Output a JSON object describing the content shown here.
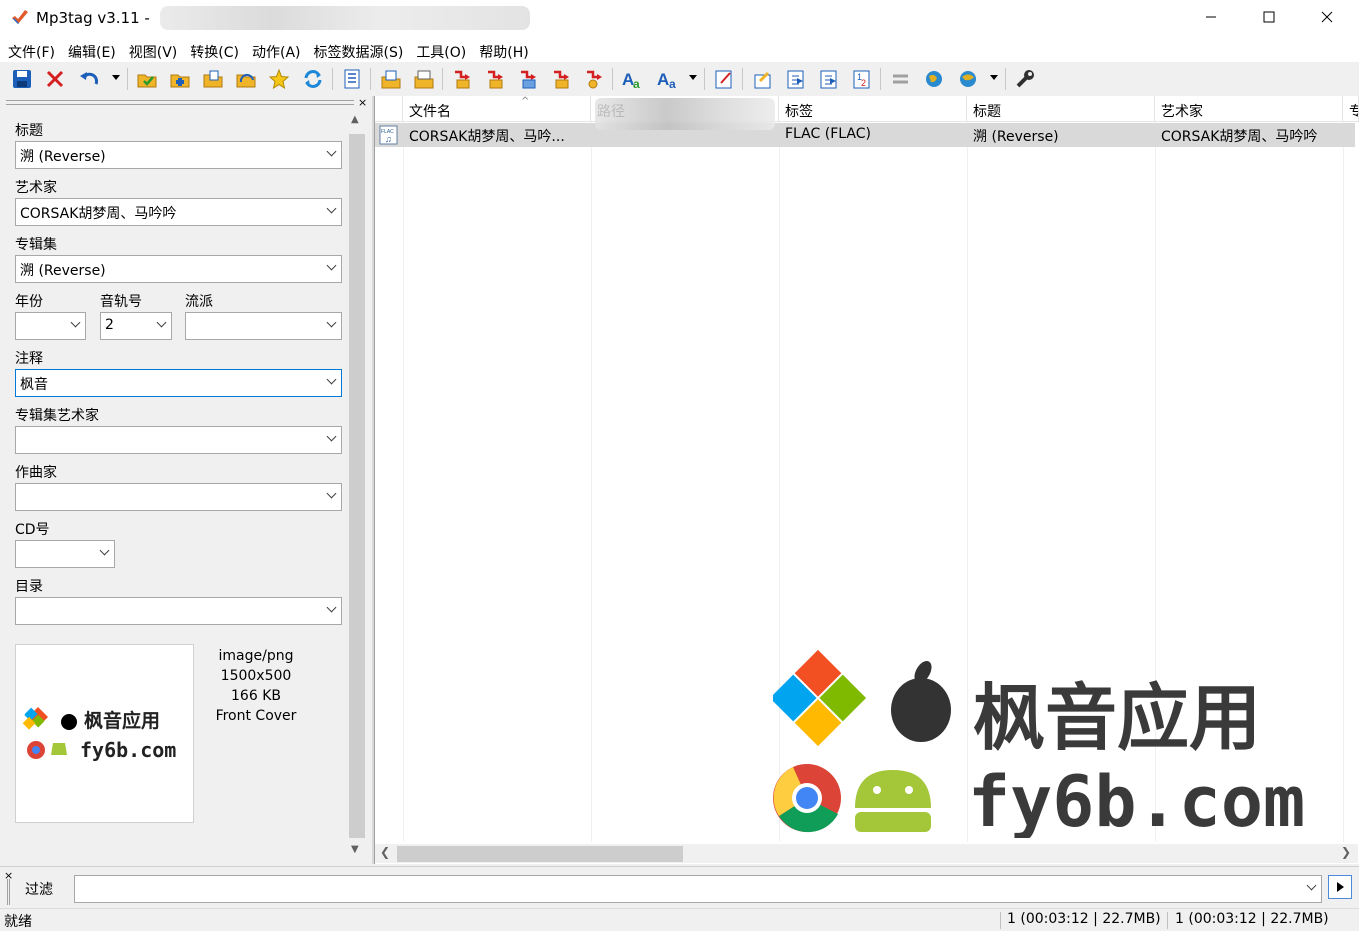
{
  "window": {
    "title": "Mp3tag v3.11  -",
    "min_icon": "minimize-icon",
    "max_icon": "maximize-icon",
    "close_icon": "close-icon"
  },
  "menu": [
    "文件(F)",
    "编辑(E)",
    "视图(V)",
    "转换(C)",
    "动作(A)",
    "标签数据源(S)",
    "工具(O)",
    "帮助(H)"
  ],
  "toolbar_icons": [
    "save-icon",
    "remove-tag-icon",
    "undo-icon",
    "change-dir-icon",
    "add-dir-icon",
    "add-folder-icon",
    "favorites-folder-icon",
    "favorite-star-icon",
    "refresh-icon",
    "options-icon",
    "export-icon",
    "playlist-icon",
    "convert-tag-filename-icon",
    "convert-filename-tag-icon",
    "convert-text-tag-icon",
    "convert-tag-tag-icon",
    "convert-tag-text-icon",
    "case-convert-icon",
    "case-convert-menu-icon",
    "edit-tag-icon",
    "actions-icon",
    "actions-quick-icon",
    "autonumber-icon",
    "number-icon",
    "compare-icon",
    "web-source-icon",
    "web-source-menu-icon",
    "tools-wrench-icon"
  ],
  "tag_panel": {
    "title_label": "标题",
    "title_value": "溯 (Reverse)",
    "artist_label": "艺术家",
    "artist_value": "CORSAK胡梦周、马吟吟",
    "album_label": "专辑集",
    "album_value": "溯 (Reverse)",
    "year_label": "年份",
    "year_value": "",
    "track_label": "音轨号",
    "track_value": "2",
    "genre_label": "流派",
    "genre_value": "",
    "comment_label": "注释",
    "comment_value": "枫音",
    "album_artist_label": "专辑集艺术家",
    "album_artist_value": "",
    "composer_label": "作曲家",
    "composer_value": "",
    "disc_label": "CD号",
    "disc_value": "",
    "directory_label": "目录",
    "directory_value": ""
  },
  "cover": {
    "mime": "image/png",
    "dimensions": "1500x500",
    "size": "166 KB",
    "type": "Front Cover",
    "watermark_text": "枫音应用",
    "watermark_domain": "fy6b.com"
  },
  "file_list": {
    "columns": [
      "文件名",
      "路径",
      "标签",
      "标题",
      "艺术家",
      "专"
    ],
    "rows": [
      {
        "filename": "CORSAK胡梦周、马吟...",
        "path": "",
        "tag": "FLAC (FLAC)",
        "title": "溯 (Reverse)",
        "artist": "CORSAK胡梦周、马吟吟"
      }
    ],
    "watermark_text": "枫音应用",
    "watermark_domain": "fy6b.com"
  },
  "filter": {
    "label": "过滤",
    "value": ""
  },
  "status": {
    "left": "就绪",
    "selected": "1 (00:03:12 | 22.7MB)",
    "total": "1 (00:03:12 | 22.7MB)"
  }
}
